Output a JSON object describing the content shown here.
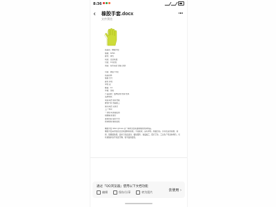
{
  "status": {
    "time": "8:36",
    "dot_colors": [
      "#e53935",
      "#43a047",
      "#ff7043"
    ],
    "battery_label": "battery-icon"
  },
  "header": {
    "back_glyph": "‹",
    "title": "橡胶手套.docx",
    "subtitle": "文件预览"
  },
  "doc": {
    "glove_color": "#cddc39",
    "block1": [
      "商品名：橡胶手套",
      "规格：S/M/L",
      "颜色：黄色",
      "材质：天然乳胶",
      "包装：12双/盒",
      "用途：家务清洁 洗碗 洗衣"
    ],
    "block2": [
      "包装：袋装 12双",
      "商品名称",
      "规格 型号",
      "颜色 黄色",
      "单位 双",
      "数量：12",
      "价格：含税",
      "产品说明：加厚耐用 防滑 防水",
      "适用场景：",
      "家庭清洁 厨房洗碗",
      "餐饮行业 食品加工",
      "医院清洁 实验室",
      "工厂车间",
      "一次性/可重复使用",
      "耐酸碱 耐油污",
      "柔软舒适 贴合手型",
      "防滑纹理 握持更稳"
    ],
    "para1": "橡胶手套 latex gloves 是一种用天然乳胶制成的防护用品。",
    "para2": "橡胶手套采用优质天然乳胶精制而成，手感柔软，富有弹性，佩戴舒适，具有优良的耐磨、耐刺、耐撕裂性能，适用于家庭清洁、餐饮服务、食品加工、医疗卫生、工业生产等多种场合，可有效保护双手免受污物、化学品的侵害。"
  },
  "banner": {
    "text": "通过「QQ浏览器」使用以下文档功能",
    "actions": [
      "编辑",
      "保存/分享",
      "转为图片"
    ],
    "action_icons": [
      "edit-icon",
      "save-icon",
      "image-icon"
    ],
    "go_label": "去使用 ›"
  }
}
